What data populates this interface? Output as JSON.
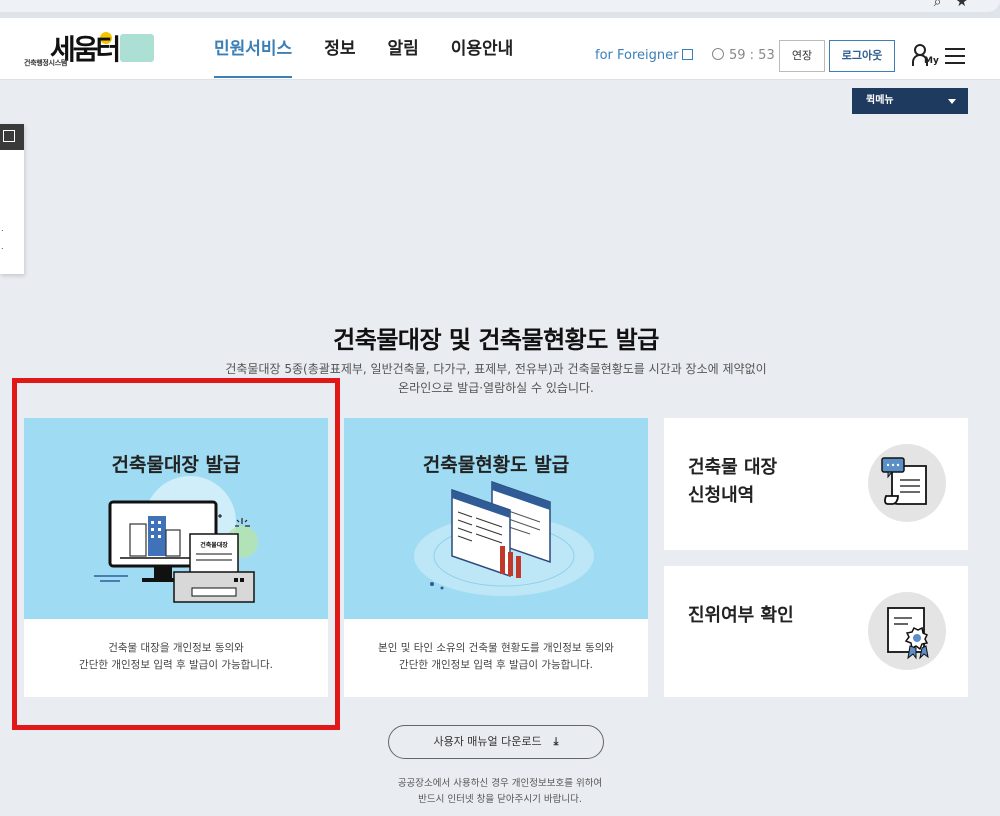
{
  "header": {
    "logo_text": "세움터",
    "logo_sub": "건축행정시스템",
    "nav": [
      "민원서비스",
      "정보",
      "알림",
      "이용안내"
    ],
    "foreigner_label": "for Foreigner",
    "timer": "59 : 53",
    "extend_label": "연장",
    "logout_label": "로그아웃",
    "my_label": "My"
  },
  "quick_menu": {
    "label": "퀵메뉴"
  },
  "section": {
    "title": "건축물대장 및 건축물현황도 발급",
    "desc_line1": "건축물대장 5종(총괄표제부, 일반건축물, 다가구, 표제부, 전유부)과 건축물현황도를 시간과 장소에 제약없이",
    "desc_line2": "온라인으로 발급·열람하실 수 있습니다."
  },
  "cards": [
    {
      "title": "건축물대장 발급",
      "doc_label": "건축물대장",
      "desc_line1": "건축물 대장을 개인정보 동의와",
      "desc_line2": "간단한 개인정보 입력 후 발급이 가능합니다."
    },
    {
      "title": "건축물현황도 발급",
      "desc_line1": "본인 및 타인 소유의 건축물 현황도를 개인정보 동의와",
      "desc_line2": "간단한 개인정보 입력 후 발급이 가능합니다."
    },
    {
      "title_line1": "건축물 대장",
      "title_line2": "신청내역"
    },
    {
      "title_line1": "진위여부 확인"
    }
  ],
  "manual_button": {
    "label": "사용자 매뉴얼 다운로드",
    "icon": "download-icon"
  },
  "footer": {
    "line1": "공공장소에서 사용하신 경우 개인정보보호를 위하여",
    "line2": "반드시 인터넷 창을 닫아주시기 바랍니다."
  },
  "colors": {
    "accent": "#3b7fb6",
    "card_bg": "#9fdcf3",
    "highlight": "#e01818",
    "quick_menu": "#1e3a5f"
  }
}
